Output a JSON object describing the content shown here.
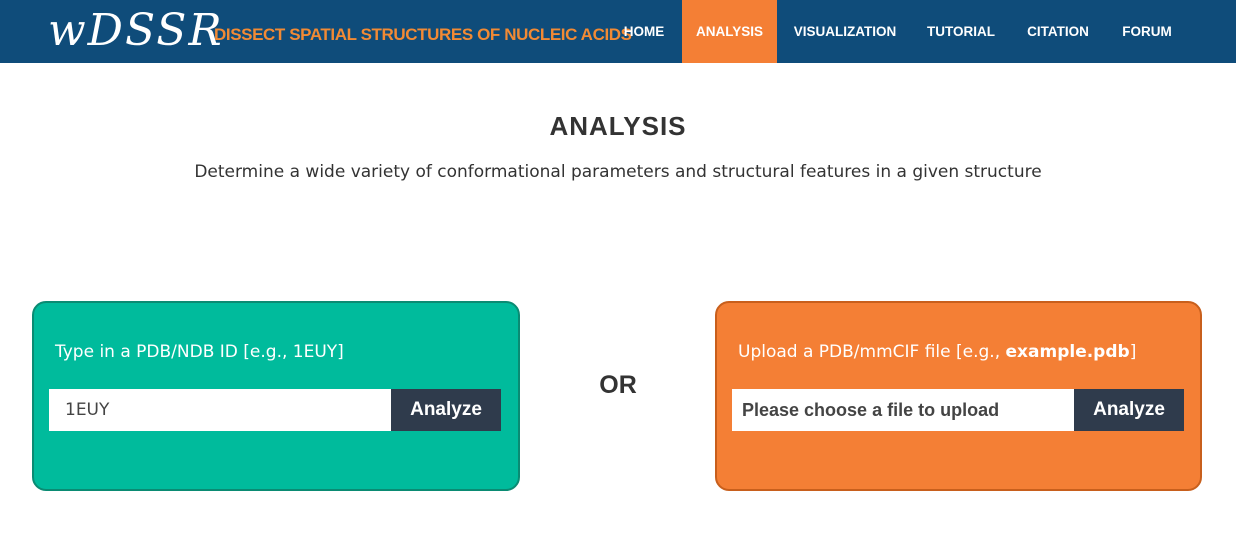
{
  "header": {
    "logo": "wDSSR",
    "tagline": "DISSECT SPATIAL STRUCTURES OF NUCLEIC ACIDS",
    "nav": [
      "HOME",
      "ANALYSIS",
      "VISUALIZATION",
      "TUTORIAL",
      "CITATION",
      "FORUM"
    ],
    "active_nav": "ANALYSIS"
  },
  "main": {
    "title": "ANALYSIS",
    "subtitle": "Determine a wide variety of conformational parameters and structural features in a given structure"
  },
  "pdb_panel": {
    "label": "Type in a PDB/NDB ID [e.g., 1EUY]",
    "input_value": "1EUY",
    "button": "Analyze"
  },
  "separator": "OR",
  "upload_panel": {
    "label_prefix": "Upload a PDB/mmCIF file [e.g., ",
    "label_example": "example.pdb",
    "label_suffix": "]",
    "file_placeholder": "Please choose a file to upload",
    "button": "Analyze"
  },
  "colors": {
    "header_bg": "#0f4c7a",
    "accent_orange": "#f47f35",
    "panel_green": "#00bb9c",
    "button_dark": "#2f3b4c"
  }
}
